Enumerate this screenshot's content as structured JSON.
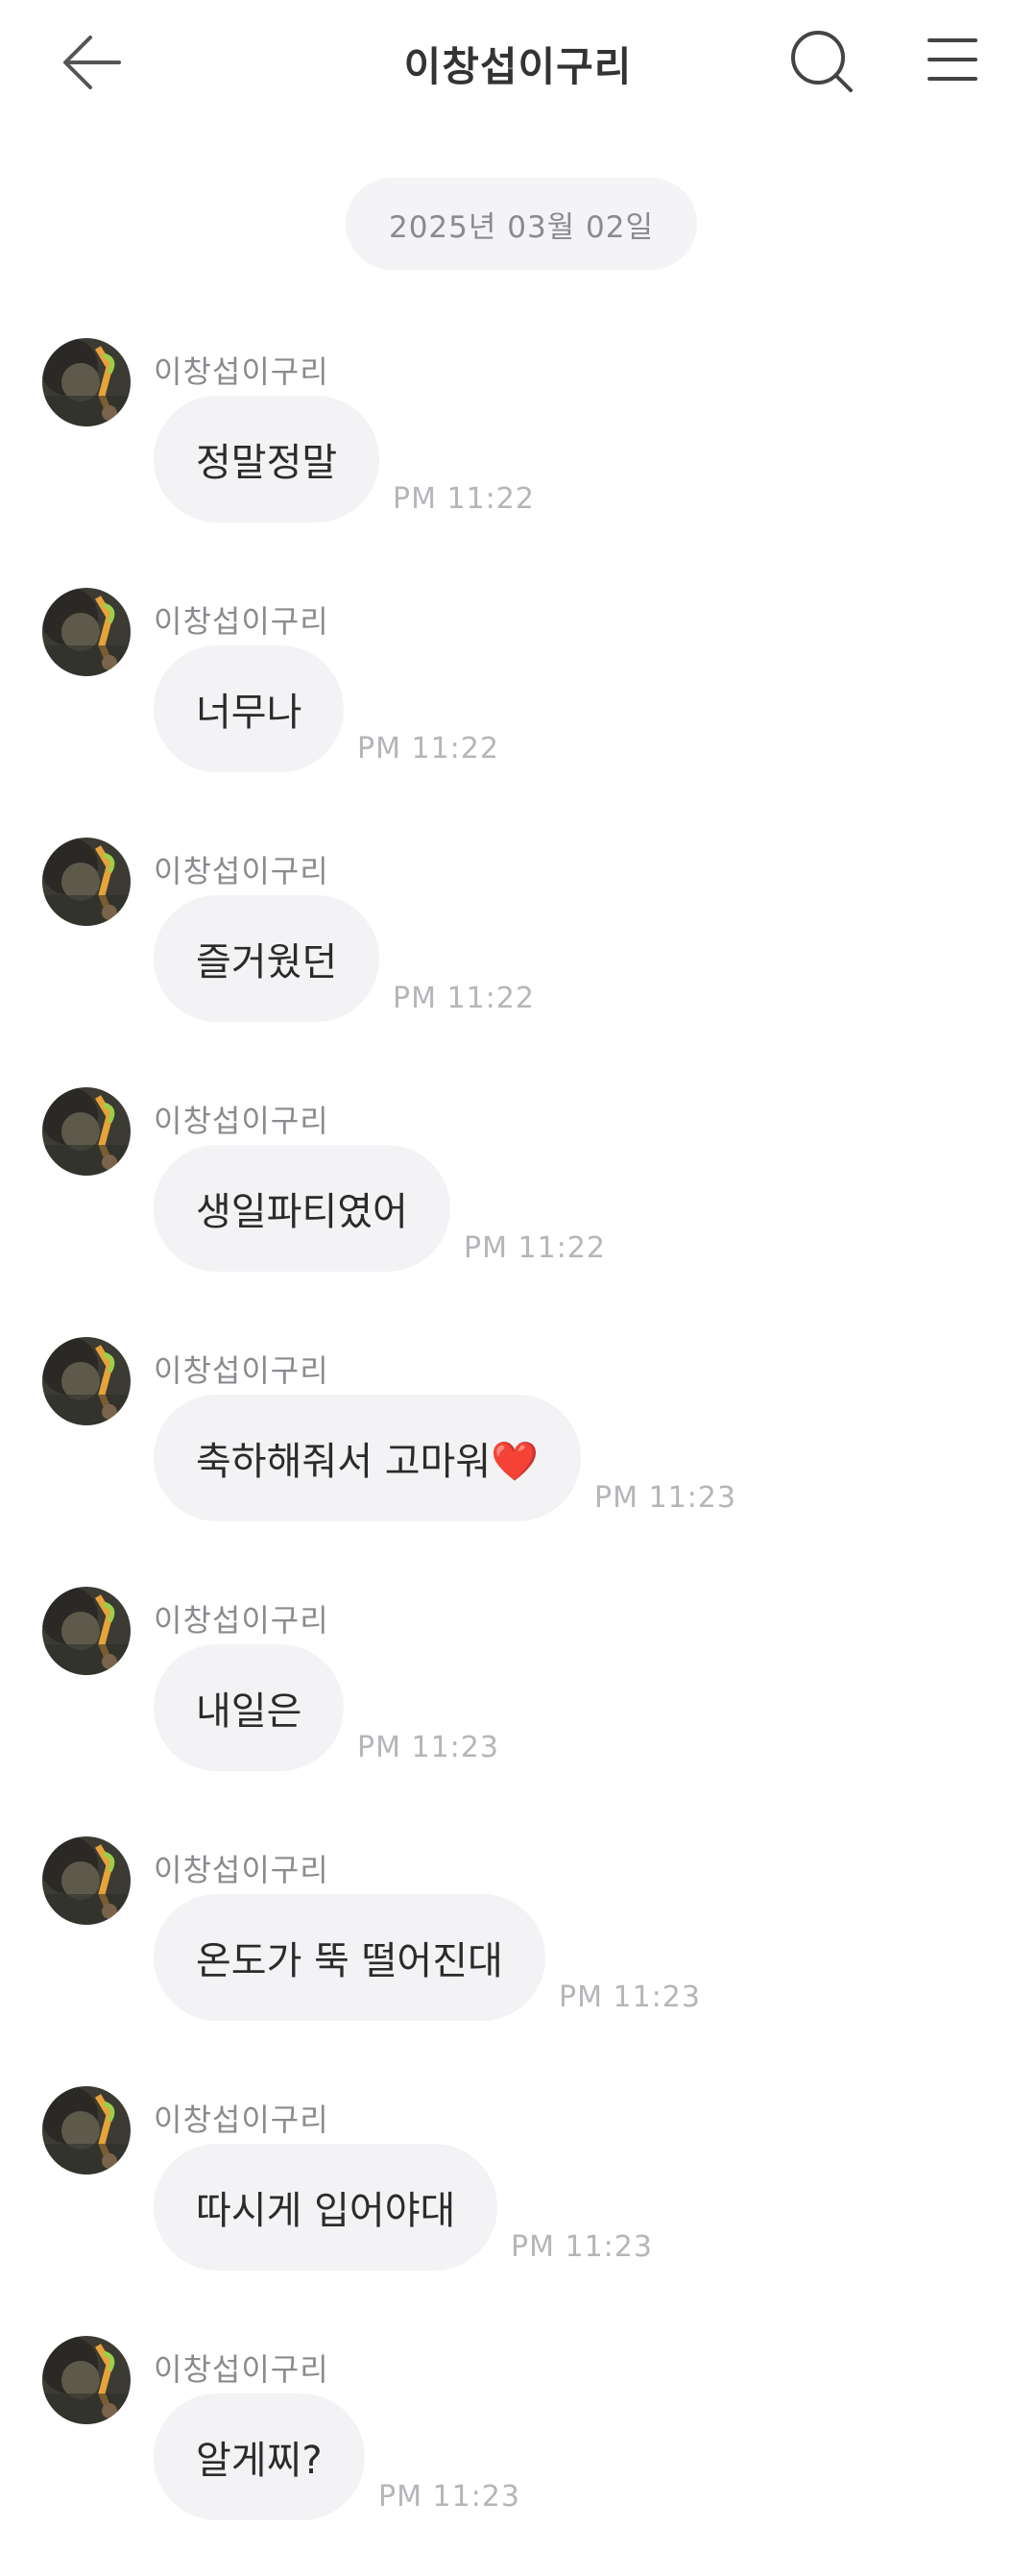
{
  "header": {
    "title": "이창섭이구리",
    "back_icon": "arrow-left-icon",
    "search_icon": "search-icon",
    "menu_icon": "hamburger-menu-icon"
  },
  "date_divider": "2025년 03월 02일",
  "messages": [
    {
      "sender": "이창섭이구리",
      "text": "정말정말",
      "time": "PM 11:22"
    },
    {
      "sender": "이창섭이구리",
      "text": "너무나",
      "time": "PM 11:22"
    },
    {
      "sender": "이창섭이구리",
      "text": "즐거웠던",
      "time": "PM 11:22"
    },
    {
      "sender": "이창섭이구리",
      "text": "생일파티였어",
      "time": "PM 11:22"
    },
    {
      "sender": "이창섭이구리",
      "text": "축하해줘서 고마워❤️",
      "time": "PM 11:23"
    },
    {
      "sender": "이창섭이구리",
      "text": "내일은",
      "time": "PM 11:23"
    },
    {
      "sender": "이창섭이구리",
      "text": "온도가 뚝 떨어진대",
      "time": "PM 11:23"
    },
    {
      "sender": "이창섭이구리",
      "text": "따시게 입어야대",
      "time": "PM 11:23"
    },
    {
      "sender": "이창섭이구리",
      "text": "알게찌?",
      "time": "PM 11:23"
    }
  ]
}
